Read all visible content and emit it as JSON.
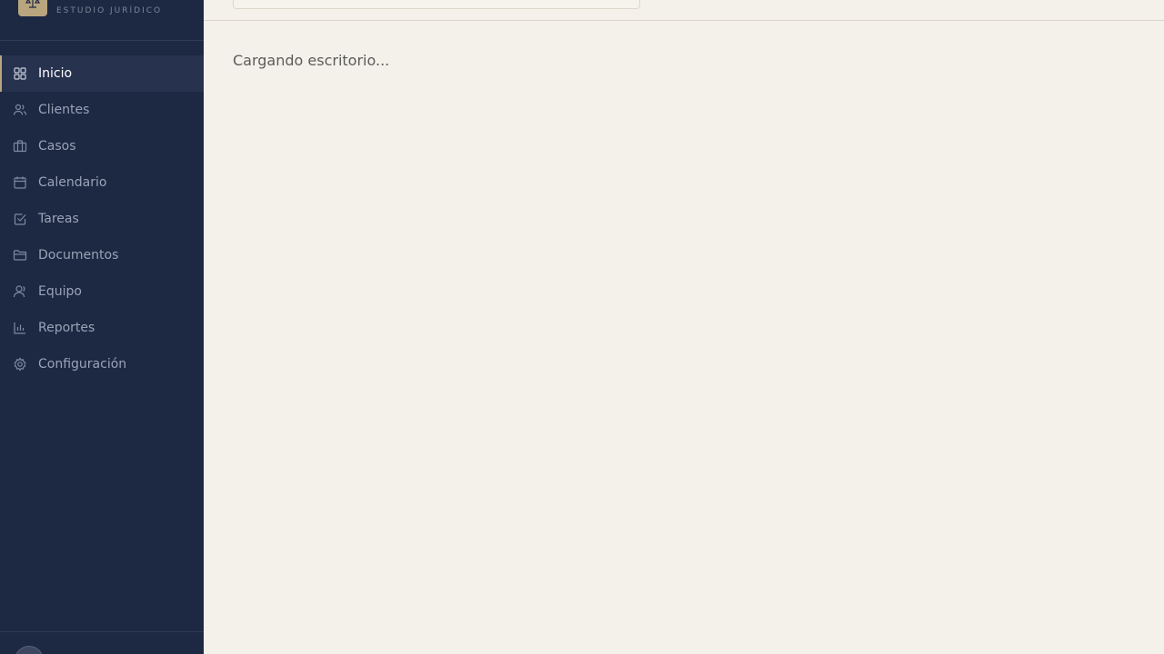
{
  "brand": {
    "subtitle": "ESTUDIO JURÍDICO",
    "logo_icon": "scales-icon",
    "accent_color": "#b9a67f"
  },
  "sidebar": {
    "items": [
      {
        "label": "Inicio",
        "icon": "grid-icon",
        "active": true
      },
      {
        "label": "Clientes",
        "icon": "users-icon",
        "active": false
      },
      {
        "label": "Casos",
        "icon": "briefcase-icon",
        "active": false
      },
      {
        "label": "Calendario",
        "icon": "calendar-icon",
        "active": false
      },
      {
        "label": "Tareas",
        "icon": "checkbox-icon",
        "active": false
      },
      {
        "label": "Documentos",
        "icon": "folder-icon",
        "active": false
      },
      {
        "label": "Equipo",
        "icon": "user-icon",
        "active": false
      },
      {
        "label": "Reportes",
        "icon": "bar-chart-icon",
        "active": false
      },
      {
        "label": "Configuración",
        "icon": "gear-icon",
        "active": false
      }
    ]
  },
  "main": {
    "loading_text": "Cargando escritorio..."
  },
  "colors": {
    "sidebar_bg": "#1d2843",
    "page_bg": "#f4f1ea"
  }
}
